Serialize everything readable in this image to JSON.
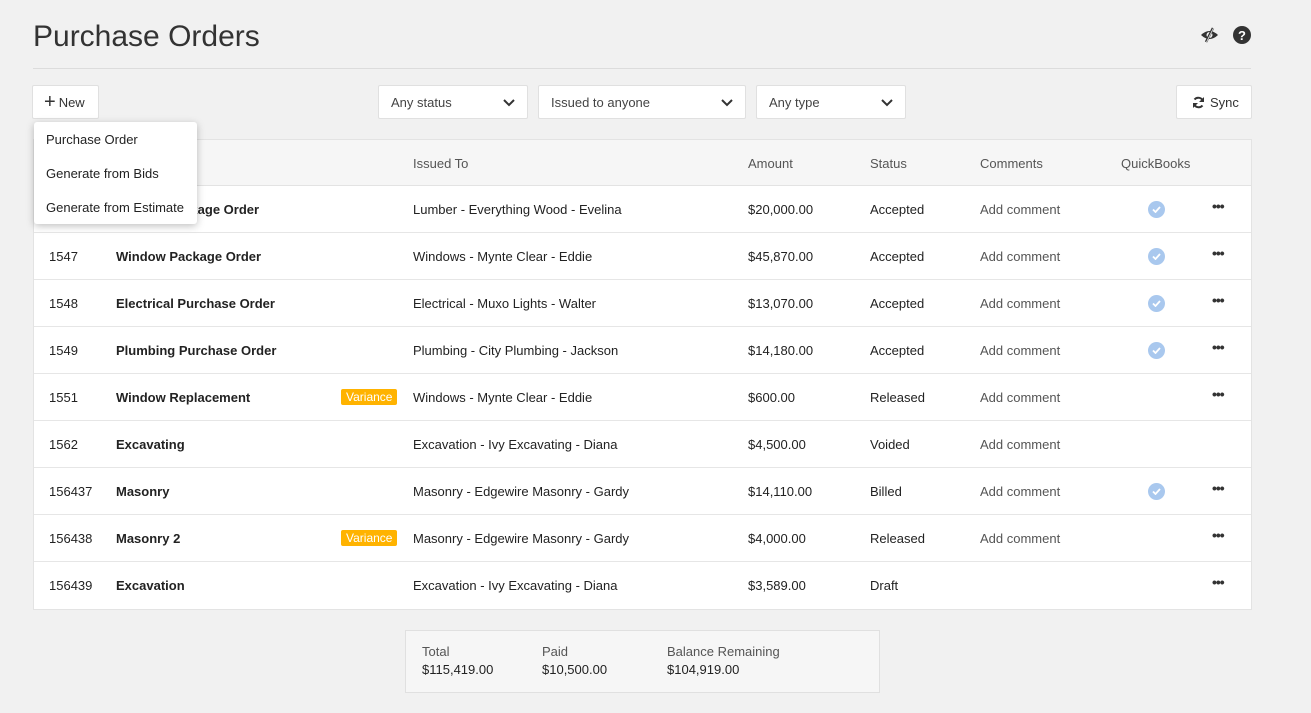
{
  "header": {
    "title": "Purchase Orders",
    "hide_icon": "eye-slash-icon",
    "help_icon": "question-circle-icon"
  },
  "toolbar": {
    "new_label": "New",
    "sync_label": "Sync",
    "filters": {
      "status": "Any status",
      "issued": "Issued to anyone",
      "type": "Any type"
    }
  },
  "new_menu": {
    "items": [
      "Purchase Order",
      "Generate from Bids",
      "Generate from Estimate"
    ]
  },
  "table": {
    "columns": {
      "issued_to": "Issued To",
      "amount": "Amount",
      "status": "Status",
      "comments": "Comments",
      "quickbooks": "QuickBooks"
    },
    "rows": [
      {
        "id": "",
        "name": "Lumber Package Order",
        "badge": "",
        "issued_to": "Lumber - Everything Wood - Evelina",
        "amount": "$20,000.00",
        "status": "Accepted",
        "comment": "Add comment",
        "qb": true,
        "menu": true
      },
      {
        "id": "1547",
        "name": "Window Package Order",
        "badge": "",
        "issued_to": "Windows - Mynte Clear - Eddie",
        "amount": "$45,870.00",
        "status": "Accepted",
        "comment": "Add comment",
        "qb": true,
        "menu": true
      },
      {
        "id": "1548",
        "name": "Electrical Purchase Order",
        "badge": "",
        "issued_to": "Electrical - Muxo Lights - Walter",
        "amount": "$13,070.00",
        "status": "Accepted",
        "comment": "Add comment",
        "qb": true,
        "menu": true
      },
      {
        "id": "1549",
        "name": "Plumbing Purchase Order",
        "badge": "",
        "issued_to": "Plumbing - City Plumbing - Jackson",
        "amount": "$14,180.00",
        "status": "Accepted",
        "comment": "Add comment",
        "qb": true,
        "menu": true
      },
      {
        "id": "1551",
        "name": "Window Replacement",
        "badge": "Variance",
        "issued_to": "Windows - Mynte Clear - Eddie",
        "amount": "$600.00",
        "status": "Released",
        "comment": "Add comment",
        "qb": false,
        "menu": true
      },
      {
        "id": "1562",
        "name": "Excavating",
        "badge": "",
        "issued_to": "Excavation - Ivy Excavating - Diana",
        "amount": "$4,500.00",
        "status": "Voided",
        "comment": "Add comment",
        "qb": false,
        "menu": false
      },
      {
        "id": "156437",
        "name": "Masonry",
        "badge": "",
        "issued_to": "Masonry - Edgewire Masonry - Gardy",
        "amount": "$14,110.00",
        "status": "Billed",
        "comment": "Add comment",
        "qb": true,
        "menu": true
      },
      {
        "id": "156438",
        "name": "Masonry 2",
        "badge": "Variance",
        "issued_to": "Masonry - Edgewire Masonry - Gardy",
        "amount": "$4,000.00",
        "status": "Released",
        "comment": "Add comment",
        "qb": false,
        "menu": true
      },
      {
        "id": "156439",
        "name": "Excavation",
        "badge": "",
        "issued_to": "Excavation - Ivy Excavating - Diana",
        "amount": "$3,589.00",
        "status": "Draft",
        "comment": "",
        "qb": false,
        "menu": true
      }
    ]
  },
  "totals": {
    "total_label": "Total",
    "total": "$115,419.00",
    "paid_label": "Paid",
    "paid": "$10,500.00",
    "balance_label": "Balance Remaining",
    "balance": "$104,919.00"
  },
  "colors": {
    "variance": "#ffb300",
    "qb_check": "#a9c8ee"
  }
}
